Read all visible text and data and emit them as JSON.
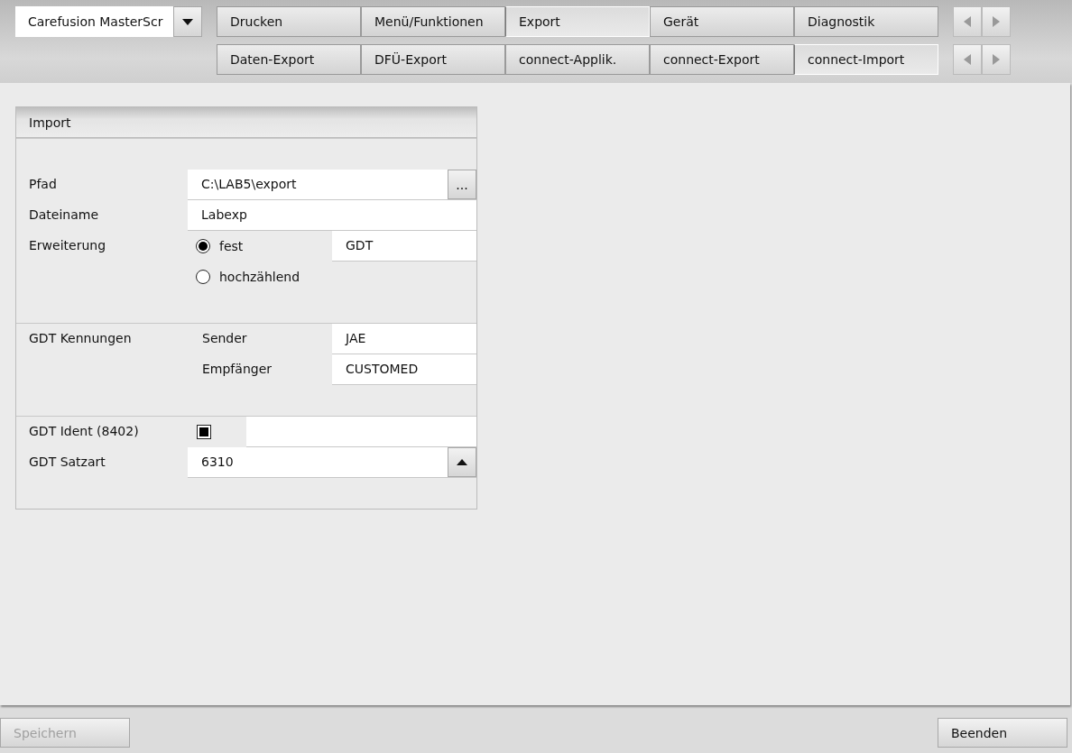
{
  "selector": {
    "value": "Carefusion MasterScr"
  },
  "tab_rows": [
    [
      {
        "label": "Drucken",
        "selected": false
      },
      {
        "label": "Menü/Funktionen",
        "selected": false
      },
      {
        "label": "Export",
        "selected": true
      },
      {
        "label": "Gerät",
        "selected": false
      },
      {
        "label": "Diagnostik",
        "selected": false
      }
    ],
    [
      {
        "label": "Daten-Export",
        "selected": false
      },
      {
        "label": "DFÜ-Export",
        "selected": false
      },
      {
        "label": "connect-Applik.",
        "selected": false
      },
      {
        "label": "connect-Export",
        "selected": false
      },
      {
        "label": "connect-Import",
        "selected": true
      }
    ]
  ],
  "panel": {
    "title": "Import",
    "path": {
      "label": "Pfad",
      "value": "C:\\LAB5\\export",
      "button": "..."
    },
    "filename": {
      "label": "Dateiname",
      "value": "Labexp"
    },
    "extension": {
      "label": "Erweiterung",
      "options": [
        {
          "label": "fest",
          "selected": true
        },
        {
          "label": "hochzählend",
          "selected": false
        }
      ],
      "value": "GDT"
    },
    "ids": {
      "label": "GDT Kennungen",
      "fields": [
        {
          "label": "Sender",
          "value": "JAE"
        },
        {
          "label": "Empfänger",
          "value": "CUSTOMED"
        }
      ]
    },
    "ident": {
      "label": "GDT Ident (8402)",
      "checked": true
    },
    "record_type": {
      "label": "GDT Satzart",
      "value": "6310"
    }
  },
  "buttons": [
    {
      "label": "Speichern",
      "disabled": true
    },
    {
      "label": "Beenden",
      "disabled": false
    }
  ]
}
